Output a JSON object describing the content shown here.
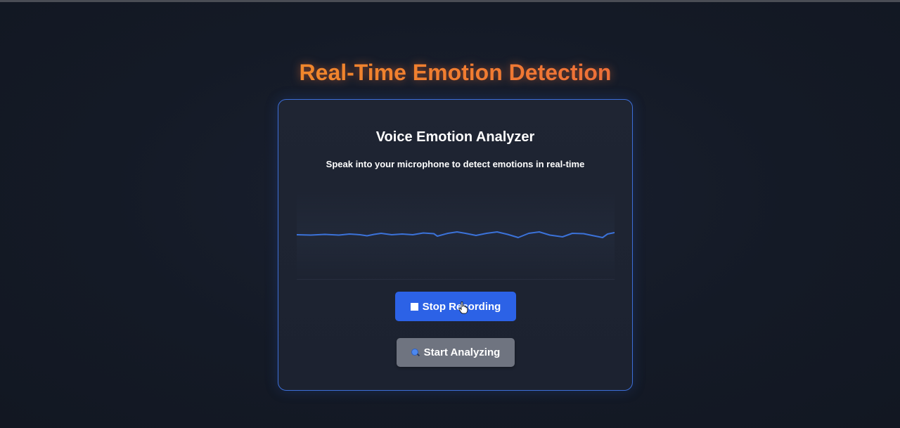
{
  "app": {
    "title": "Real-Time Emotion Detection"
  },
  "card": {
    "title": "Voice Emotion Analyzer",
    "subtitle": "Speak into your microphone to detect emotions in real-time"
  },
  "waveform": {
    "icon": "audio-waveform",
    "color": "#3b72d9"
  },
  "buttons": {
    "stop_label": "Stop Recording",
    "stop_icon": "stop-square-icon",
    "analyze_label": "Start Analyzing",
    "analyze_icon": "magnifier-icon"
  },
  "colors": {
    "background": "#131824",
    "card_border": "#3d6fd8",
    "primary_button": "#2c62e6",
    "secondary_button": "#6f7480",
    "title_gradient_start": "#f29a22",
    "title_gradient_end": "#e9524a"
  }
}
